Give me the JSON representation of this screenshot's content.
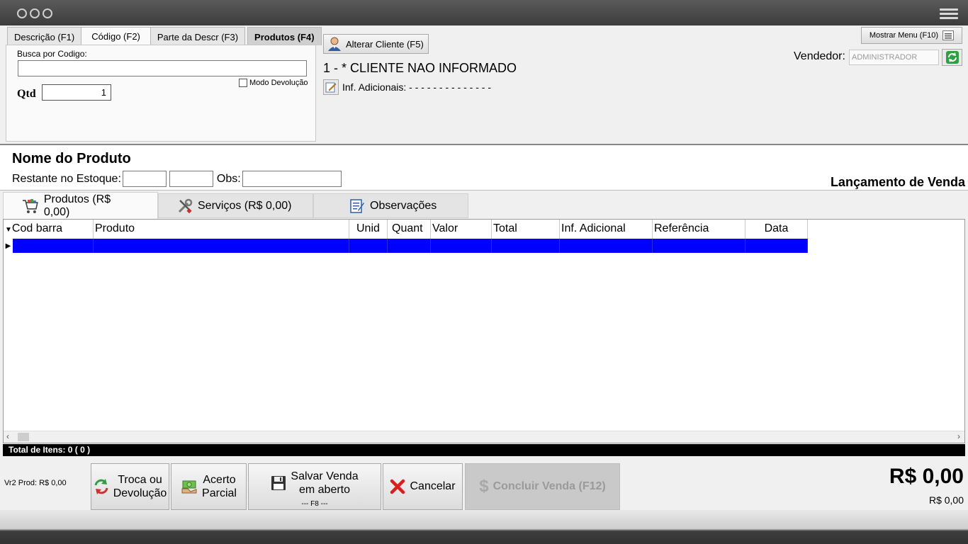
{
  "search_tabs": [
    {
      "label": "Descrição (F1)"
    },
    {
      "label": "Código (F2)"
    },
    {
      "label": "Parte da Descr (F3)"
    },
    {
      "label": "Produtos (F4)"
    }
  ],
  "search": {
    "busca_label": "Busca por Codigo:",
    "busca_value": "",
    "modo_devolucao_label": "Modo Devolução",
    "qtd_label": "Qtd",
    "qtd_value": "1"
  },
  "cliente": {
    "alterar_label": "Alterar Cliente (F5)",
    "nome": "1 - * CLIENTE NAO INFORMADO",
    "inf_adicionais": "Inf. Adicionais: - - - - - - - - - - - - - -"
  },
  "menu": {
    "mostrar_label": "Mostrar Menu (F10)"
  },
  "vendedor": {
    "label": "Vendedor:",
    "value": "ADMINISTRADOR"
  },
  "produto_info": {
    "nome_label": "Nome do Produto",
    "estoque_label": "Restante no Estoque:",
    "obs_label": "Obs:",
    "lancamento_title": "Lançamento de Venda"
  },
  "list_tabs": [
    {
      "label": "Produtos (R$ 0,00)"
    },
    {
      "label": "Serviços (R$ 0,00)"
    },
    {
      "label": "Observações"
    }
  ],
  "grid": {
    "columns": [
      "Cod barra",
      "Produto",
      "Unid",
      "Quant",
      "Valor",
      "Total",
      "Inf. Adicional",
      "Referência",
      "Data"
    ]
  },
  "total_itens": "Total de Itens:  0  ( 0 )",
  "bottom": {
    "vr2_prod": "Vr2 Prod:  R$ 0,00",
    "troca_line1": "Troca ou",
    "troca_line2": "Devolução",
    "acerto_line1": "Acerto",
    "acerto_line2": "Parcial",
    "salvar_line1": "Salvar Venda",
    "salvar_line2": "em aberto",
    "salvar_note": "--- F8 ---",
    "cancelar_label": "Cancelar",
    "concluir_label": "Concluir Venda (F12)",
    "total_big": "R$ 0,00",
    "total_small": "R$ 0,00"
  },
  "colors": {
    "selected_row": "#0000ff",
    "title_bar": "#4a4a4a",
    "total_bar": "#000000"
  }
}
